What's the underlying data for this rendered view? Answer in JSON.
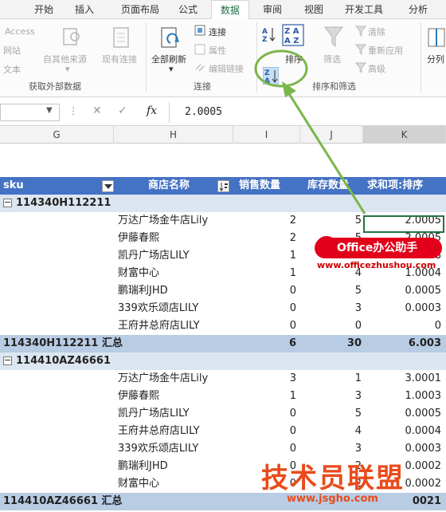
{
  "ribbon_tabs": [
    "开始",
    "插入",
    "页面布局",
    "公式",
    "数据",
    "审阅",
    "视图",
    "开发工具",
    "分析"
  ],
  "active_tab": "数据",
  "ribbon": {
    "external_data": {
      "access": "Access",
      "web": "网站",
      "text": "文本",
      "other_sources": "自其他来源",
      "existing_connections": "现有连接",
      "group_label": "获取外部数据"
    },
    "connections": {
      "refresh_all": "全部刷新",
      "connections": "连接",
      "properties": "属性",
      "edit_links": "编辑链接",
      "group_label": "连接"
    },
    "sort_filter": {
      "sort": "排序",
      "filter": "筛选",
      "clear": "清除",
      "reapply": "重新应用",
      "advanced": "高级",
      "group_label": "排序和筛选"
    },
    "split": "分列"
  },
  "formula_bar": {
    "value": "2.0005",
    "fx": "fx"
  },
  "columns": [
    "G",
    "H",
    "I",
    "J",
    "K"
  ],
  "pivot": {
    "headers": [
      "sku",
      "商店名称",
      "销售数量",
      "库存数量",
      "求和项:排序"
    ],
    "groups": [
      {
        "sku": "114340H112211",
        "rows": [
          {
            "store": "万达广场金牛店Lily",
            "sales": "2",
            "stock": "5",
            "sum": "2.0005"
          },
          {
            "store": "伊藤春熙",
            "sales": "2",
            "stock": "5",
            "sum": "2.0005"
          },
          {
            "store": "凯丹广场店LILY",
            "sales": "1",
            "stock": "8",
            "sum": "1.0008"
          },
          {
            "store": "财富中心",
            "sales": "1",
            "stock": "4",
            "sum": "1.0004"
          },
          {
            "store": "鹏瑞利JHD",
            "sales": "0",
            "stock": "5",
            "sum": "0.0005"
          },
          {
            "store": "339欢乐颂店LILY",
            "sales": "0",
            "stock": "3",
            "sum": "0.0003"
          },
          {
            "store": "王府井总府店LILY",
            "sales": "0",
            "stock": "0",
            "sum": "0"
          }
        ],
        "total_label": "114340H112211 汇总",
        "total": {
          "sales": "6",
          "stock": "30",
          "sum": "6.003"
        }
      },
      {
        "sku": "114410AZ46661",
        "rows": [
          {
            "store": "万达广场金牛店Lily",
            "sales": "3",
            "stock": "1",
            "sum": "3.0001"
          },
          {
            "store": "伊藤春熙",
            "sales": "1",
            "stock": "3",
            "sum": "1.0003"
          },
          {
            "store": "凯丹广场店LILY",
            "sales": "0",
            "stock": "5",
            "sum": "0.0005"
          },
          {
            "store": "王府井总府店LILY",
            "sales": "0",
            "stock": "4",
            "sum": "0.0004"
          },
          {
            "store": "339欢乐颂店LILY",
            "sales": "0",
            "stock": "3",
            "sum": "0.0003"
          },
          {
            "store": "鹏瑞利JHD",
            "sales": "0",
            "stock": "2",
            "sum": "0.0002"
          },
          {
            "store": "财富中心",
            "sales": "0",
            "stock": "2",
            "sum": "0.0002"
          }
        ],
        "total_label": "114410AZ46661 汇总",
        "total": {
          "sales": "",
          "stock": "",
          "sum": "0021"
        }
      }
    ]
  },
  "watermarks": {
    "office_badge": "Office办公助手",
    "office_url": "www.officezhushou.com",
    "site_logo": "技术员联盟",
    "site_url": "www.jsgho.com"
  },
  "colors": {
    "accent": "#217346",
    "pivot_header": "#4472c4",
    "highlight_circle": "#7ab648"
  }
}
